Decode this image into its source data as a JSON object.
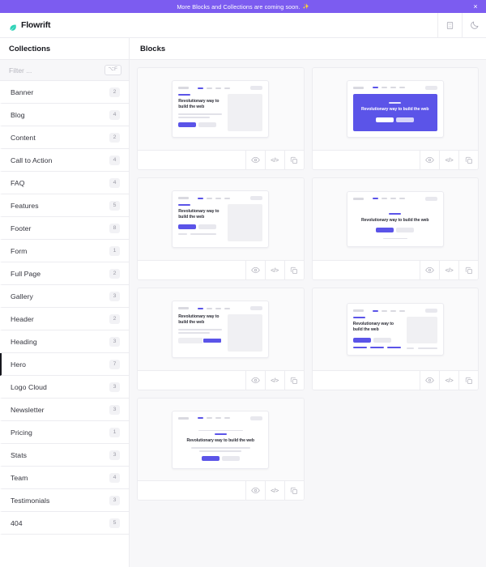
{
  "announcement": {
    "text": "More Blocks and Collections are coming soon.",
    "emoji": "✨",
    "close_label": "×",
    "bg_color": "#7c5cf0"
  },
  "header": {
    "brand_name": "Flowrift",
    "brand_icon": "leaf-logo-icon",
    "brand_color": "#2ed3b7",
    "actions": [
      {
        "name": "grid-view-icon",
        "label": ""
      },
      {
        "name": "dark-mode-moon-icon",
        "label": ""
      }
    ]
  },
  "sidebar": {
    "title": "Collections",
    "filter": {
      "placeholder": "Filter ...",
      "value": "",
      "shortcut": "⌥F"
    },
    "active_item": "Hero",
    "items": [
      {
        "label": "Banner",
        "count": "2"
      },
      {
        "label": "Blog",
        "count": "4"
      },
      {
        "label": "Content",
        "count": "2"
      },
      {
        "label": "Call to Action",
        "count": "4"
      },
      {
        "label": "FAQ",
        "count": "4"
      },
      {
        "label": "Features",
        "count": "5"
      },
      {
        "label": "Footer",
        "count": "8"
      },
      {
        "label": "Form",
        "count": "1"
      },
      {
        "label": "Full Page",
        "count": "2"
      },
      {
        "label": "Gallery",
        "count": "3"
      },
      {
        "label": "Header",
        "count": "2"
      },
      {
        "label": "Heading",
        "count": "3"
      },
      {
        "label": "Hero",
        "count": "7"
      },
      {
        "label": "Logo Cloud",
        "count": "3"
      },
      {
        "label": "Newsletter",
        "count": "3"
      },
      {
        "label": "Pricing",
        "count": "1"
      },
      {
        "label": "Stats",
        "count": "3"
      },
      {
        "label": "Team",
        "count": "4"
      },
      {
        "label": "Testimonials",
        "count": "3"
      },
      {
        "label": "404",
        "count": "5"
      }
    ]
  },
  "main": {
    "title": "Blocks",
    "accent_color": "#5b54e8",
    "card_actions": [
      {
        "name": "preview-eye-icon",
        "label": ""
      },
      {
        "name": "view-code-icon",
        "label": "</>"
      },
      {
        "name": "copy-icon",
        "label": ""
      }
    ],
    "blocks": [
      {
        "id": 1,
        "variant": "split-image",
        "heading": "Revolutionary way to build the web"
      },
      {
        "id": 2,
        "variant": "purple-hero",
        "heading": "Revolutionary way to build the web"
      },
      {
        "id": 3,
        "variant": "split-image-foot",
        "heading": "Revolutionary way to build the web"
      },
      {
        "id": 4,
        "variant": "centered-short",
        "heading": "Revolutionary way to build the web"
      },
      {
        "id": 5,
        "variant": "split-input",
        "heading": "Revolutionary way to build the web"
      },
      {
        "id": 6,
        "variant": "split-logos",
        "heading": "Revolutionary way to build the web"
      },
      {
        "id": 7,
        "variant": "centered-full",
        "heading": "Revolutionary way to build the web"
      }
    ]
  }
}
